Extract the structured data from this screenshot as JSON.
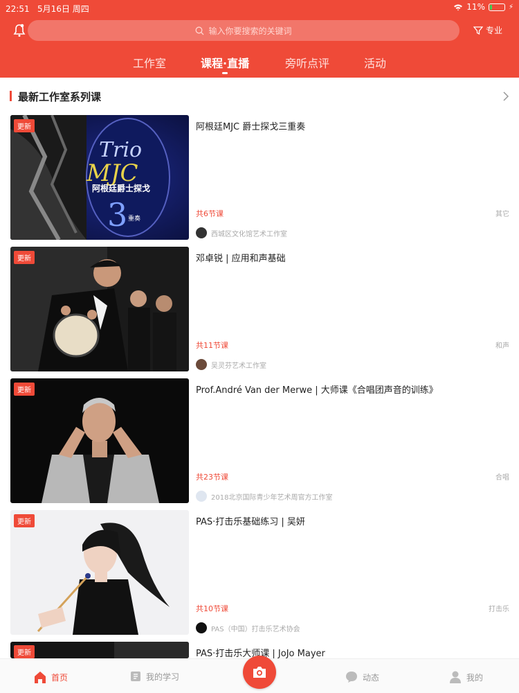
{
  "status": {
    "time": "22:51",
    "date": "5月16日 周四",
    "battery": "11%"
  },
  "search": {
    "placeholder": "输入你要搜索的关键词"
  },
  "filter_label": "专业",
  "tabs": [
    {
      "label": "工作室"
    },
    {
      "label": "课程·直播"
    },
    {
      "label": "旁听点评"
    },
    {
      "label": "活动"
    }
  ],
  "section": {
    "title": "最新工作室系列课"
  },
  "courses": [
    {
      "badge": "更新",
      "title": "阿根廷MJC 爵士探戈三重奏",
      "count": "共6节课",
      "category": "其它",
      "studio": "西城区文化馆艺术工作室"
    },
    {
      "badge": "更新",
      "title": "邓卓锐 | 应用和声基础",
      "count": "共11节课",
      "category": "和声",
      "studio": "吴灵芬艺术工作室"
    },
    {
      "badge": "更新",
      "title": "Prof.André Van der Merwe | 大师课《合唱团声音的训练》",
      "count": "共23节课",
      "category": "合唱",
      "studio": "2018北京国际青少年艺术周官方工作室"
    },
    {
      "badge": "更新",
      "title": "PAS·打击乐基础练习 | 吴妍",
      "count": "共10节课",
      "category": "打击乐",
      "studio": "PAS（中国）打击乐艺术协会"
    },
    {
      "badge": "更新",
      "title": "PAS·打击乐大师课 |  JoJo Mayer"
    }
  ],
  "thumb_texts": {
    "mjc_title": "阿根廷爵士探戈",
    "mjc_sub": "重奏"
  },
  "bottom_nav": [
    {
      "label": "首页"
    },
    {
      "label": "我的学习"
    },
    {
      "label": "动态"
    },
    {
      "label": "我的"
    }
  ],
  "colors": {
    "brand": "#ef4a38"
  }
}
